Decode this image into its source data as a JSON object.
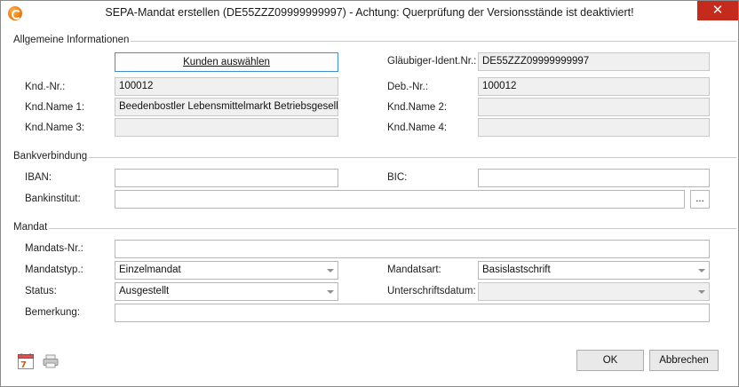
{
  "window": {
    "title": "SEPA-Mandat erstellen (DE55ZZZ09999999997) - Achtung: Querprüfung der Versionsstände ist deaktiviert!",
    "close_glyph": "✕",
    "app_icon": "app-logo-icon"
  },
  "allgemein": {
    "group_label": "Allgemeine Informationen",
    "kunden_button": "Kunden auswählen",
    "glaeubiger_label": "Gläubiger-Ident.Nr.:",
    "glaeubiger_value": "DE55ZZZ09999999997",
    "kndnr_label": "Knd.-Nr.:",
    "kndnr_value": "100012",
    "debnr_label": "Deb.-Nr.:",
    "debnr_value": "100012",
    "kndname1_label": "Knd.Name 1:",
    "kndname1_value": "Beedenbostler Lebensmittelmarkt Betriebsgesellscha",
    "kndname2_label": "Knd.Name 2:",
    "kndname2_value": "",
    "kndname3_label": "Knd.Name 3:",
    "kndname3_value": "",
    "kndname4_label": "Knd.Name 4:",
    "kndname4_value": ""
  },
  "bank": {
    "group_label": "Bankverbindung",
    "iban_label": "IBAN:",
    "iban_value": "",
    "bic_label": "BIC:",
    "bic_value": "",
    "bankinstitut_label": "Bankinstitut:",
    "bankinstitut_value": "",
    "browse_button": "..."
  },
  "mandat": {
    "group_label": "Mandat",
    "mandatsnr_label": "Mandats-Nr.:",
    "mandatsnr_value": "",
    "mandatstyp_label": "Mandatstyp.:",
    "mandatstyp_value": "Einzelmandat",
    "mandatsart_label": "Mandatsart:",
    "mandatsart_value": "Basislastschrift",
    "status_label": "Status:",
    "status_value": "Ausgestellt",
    "unterschriftsdatum_label": "Unterschriftsdatum:",
    "unterschriftsdatum_value": "",
    "bemerkung_label": "Bemerkung:",
    "bemerkung_value": ""
  },
  "footer": {
    "calendar_icon_text": "7",
    "ok_label": "OK",
    "cancel_label": "Abbrechen"
  },
  "colors": {
    "close_button": "#c42b1c",
    "focus_border": "#3f8fd6",
    "readonly_bg": "#f0f0f0"
  }
}
